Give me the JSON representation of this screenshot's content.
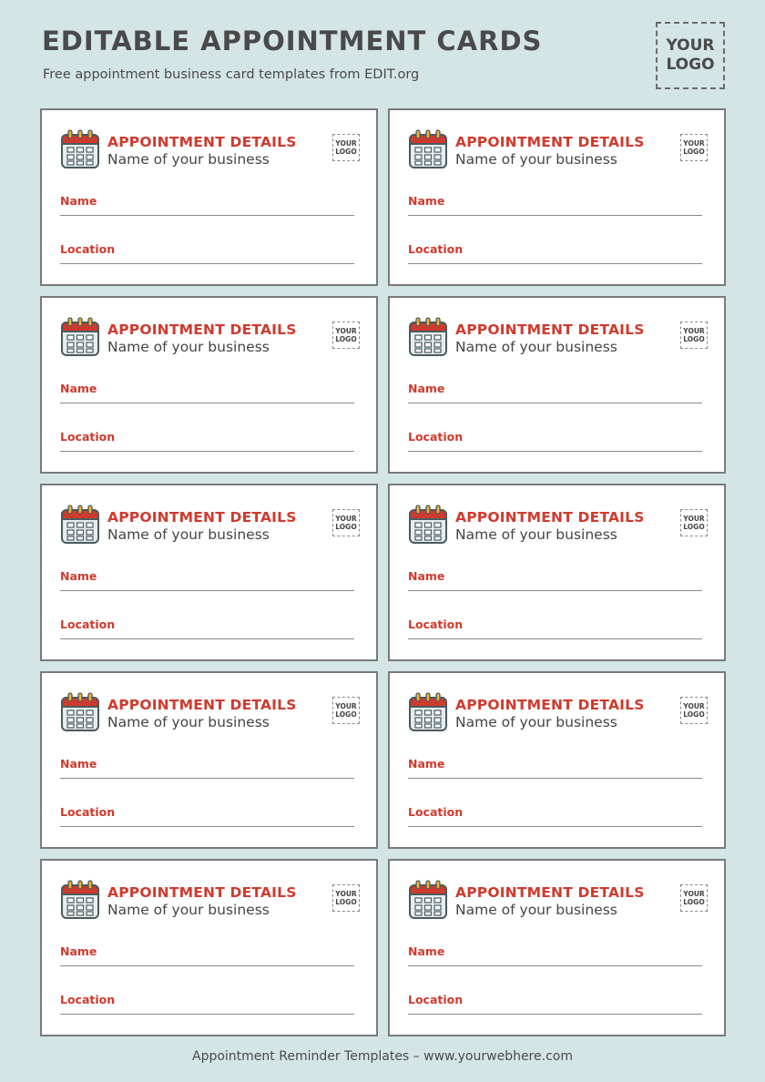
{
  "page": {
    "title": "Editable Appointment Cards",
    "subtitle": "Free appointment business card templates from EDIT.org",
    "logo_line1": "YOUR",
    "logo_line2": "LOGO",
    "footer": "Appointment Reminder Templates – www.yourwebhere.com"
  },
  "card": {
    "heading": "Appointment Details",
    "business": "Name of your business",
    "logo_line1": "YOUR",
    "logo_line2": "LOGO",
    "name_label": "Name",
    "location_label": "Location"
  },
  "colors": {
    "background": "#d4e5e6",
    "accent_red": "#d03a2d",
    "text_gray": "#4a4a4a",
    "icon": "calendar-icon"
  }
}
